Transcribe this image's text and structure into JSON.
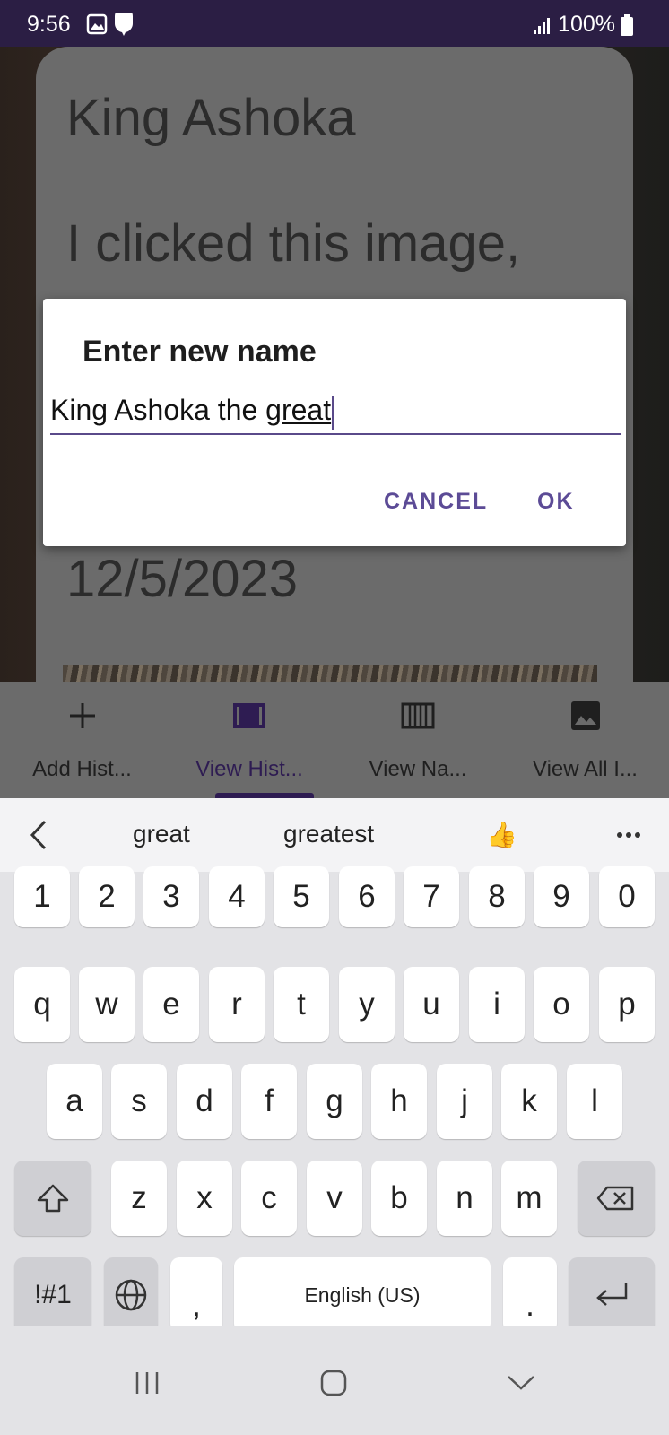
{
  "status": {
    "time": "9:56",
    "battery": "100%"
  },
  "card": {
    "title": "King Ashoka",
    "text": "I clicked this image,",
    "date": "12/5/2023"
  },
  "dialog": {
    "title": "Enter new name",
    "value_plain": "King Ashoka the ",
    "value_underlined": "great",
    "cancel": "CANCEL",
    "ok": "OK"
  },
  "nav": {
    "items": [
      {
        "label": "Add Hist...",
        "icon": "plus-icon"
      },
      {
        "label": "View Hist...",
        "icon": "film-icon"
      },
      {
        "label": "View Na...",
        "icon": "view-columns-icon"
      },
      {
        "label": "View All I...",
        "icon": "image-icon"
      }
    ]
  },
  "keyboard": {
    "suggestions": [
      "great",
      "greatest",
      "👍"
    ],
    "row_numbers": [
      "1",
      "2",
      "3",
      "4",
      "5",
      "6",
      "7",
      "8",
      "9",
      "0"
    ],
    "row1": [
      "q",
      "w",
      "e",
      "r",
      "t",
      "y",
      "u",
      "i",
      "o",
      "p"
    ],
    "row2": [
      "a",
      "s",
      "d",
      "f",
      "g",
      "h",
      "j",
      "k",
      "l"
    ],
    "row3": [
      "z",
      "x",
      "c",
      "v",
      "b",
      "n",
      "m"
    ],
    "symbols_label": "!#1",
    "comma": ",",
    "space_label": "English (US)",
    "period": "."
  },
  "colors": {
    "accent": "#5c4b96",
    "status_bar": "#2b1e44",
    "nav_active": "#2e1c52"
  }
}
